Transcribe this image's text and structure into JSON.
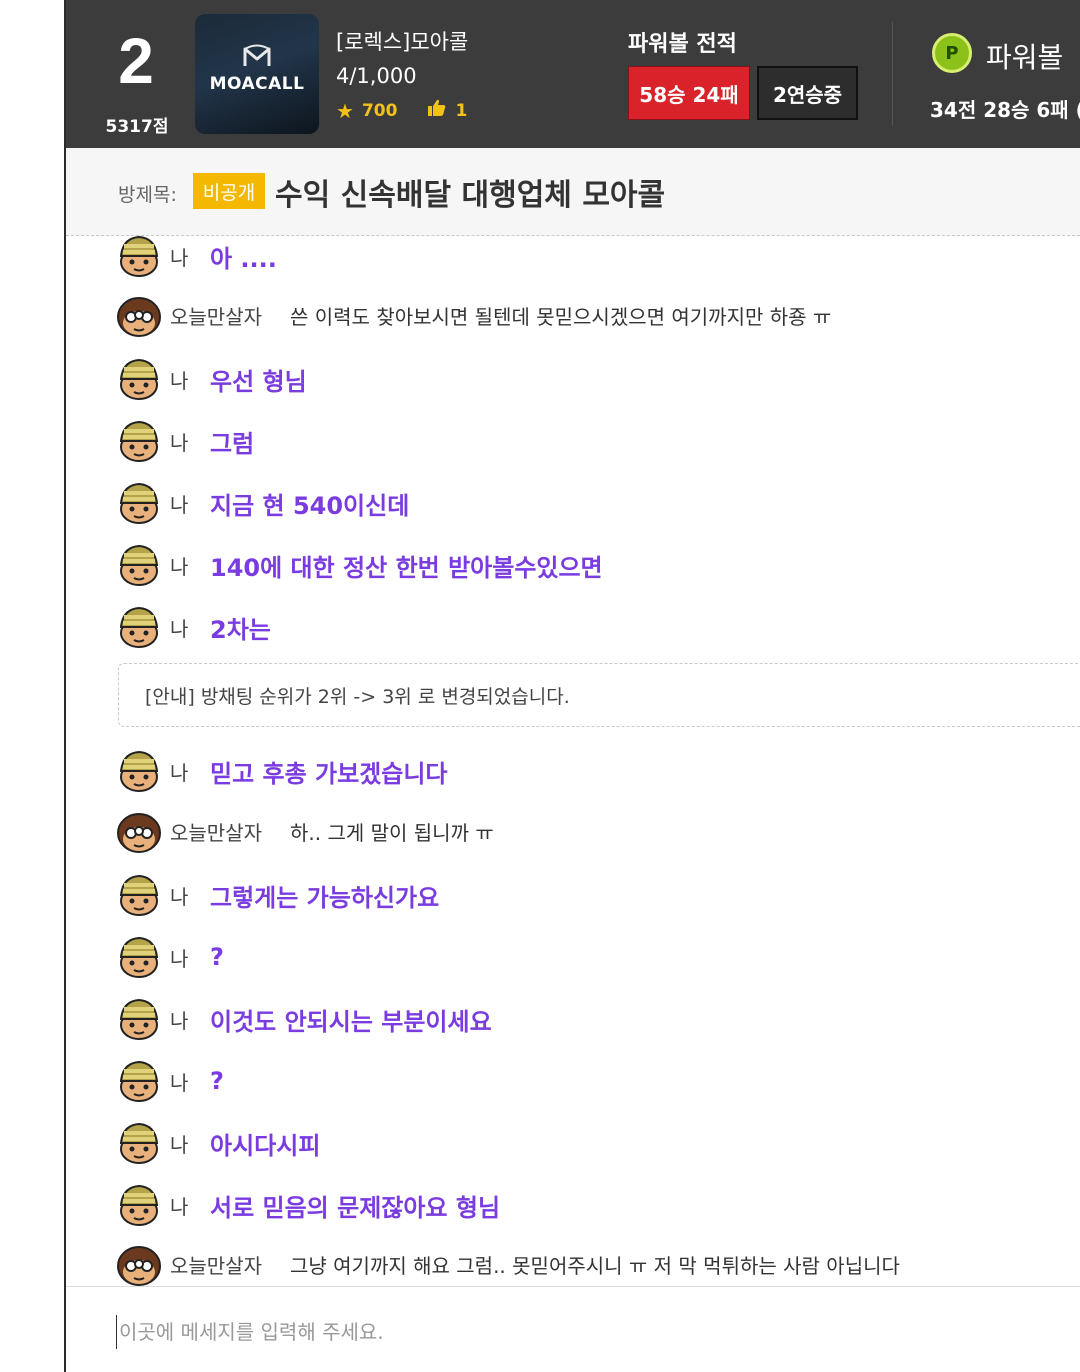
{
  "header": {
    "rank": "2",
    "points": "5317점",
    "thumbnail_logo_text": "MOACALL",
    "room_name": "[로렉스]모아콜",
    "room_count": "4/1,000",
    "stars": "700",
    "likes": "1",
    "record_title": "파워볼 전적",
    "record": "58승 24패",
    "streak": "2연승중",
    "game_name": "파워볼",
    "game_record": "34전 28승 6패 (",
    "record_color": "#d9222a",
    "game_icon_letter": "P"
  },
  "titlebar": {
    "prefix": "방제목:",
    "private_badge": "비공개",
    "title": "수익 신속배달 대행업체 모아콜"
  },
  "messages": [
    {
      "who": "me",
      "name": "나",
      "text": "아 ...."
    },
    {
      "who": "other",
      "name": "오늘만살자",
      "text": "쓴 이력도 찾아보시면 될텐데 못믿으시겠으면 여기까지만 하죵 ㅠ"
    },
    {
      "who": "me",
      "name": "나",
      "text": "우선 형님"
    },
    {
      "who": "me",
      "name": "나",
      "text": "그럼"
    },
    {
      "who": "me",
      "name": "나",
      "text": "지금 현 540이신데"
    },
    {
      "who": "me",
      "name": "나",
      "text": "140에 대한 정산 한번 받아볼수있으면"
    },
    {
      "who": "me",
      "name": "나",
      "text": "2차는"
    },
    {
      "who": "me",
      "name": "나",
      "text": "믿고 후총 가보겠습니다"
    },
    {
      "who": "other",
      "name": "오늘만살자",
      "text": "하.. 그게 말이 됩니까 ㅠ"
    },
    {
      "who": "me",
      "name": "나",
      "text": "그렇게는 가능하신가요"
    },
    {
      "who": "me",
      "name": "나",
      "text": "?"
    },
    {
      "who": "me",
      "name": "나",
      "text": "이것도 안되시는 부분이세요"
    },
    {
      "who": "me",
      "name": "나",
      "text": "?"
    },
    {
      "who": "me",
      "name": "나",
      "text": "아시다시피"
    },
    {
      "who": "me",
      "name": "나",
      "text": "서로 믿음의 문제잖아요 형님"
    },
    {
      "who": "other",
      "name": "오늘만살자",
      "text": "그냥 여기까지 해요 그럼.. 못믿어주시니 ㅠ 저 막 먹튀하는 사람 아닙니다"
    }
  ],
  "notice": "[안내] 방채팅 순위가 2위 -> 3위 로 변경되었습니다.",
  "input": {
    "placeholder": "이곳에 메세지를 입력해 주세요."
  },
  "colors": {
    "my_message": "#7a3be0",
    "header_bg": "#3c3c3c",
    "private_badge": "#f5b800",
    "star": "#f2c21b"
  }
}
